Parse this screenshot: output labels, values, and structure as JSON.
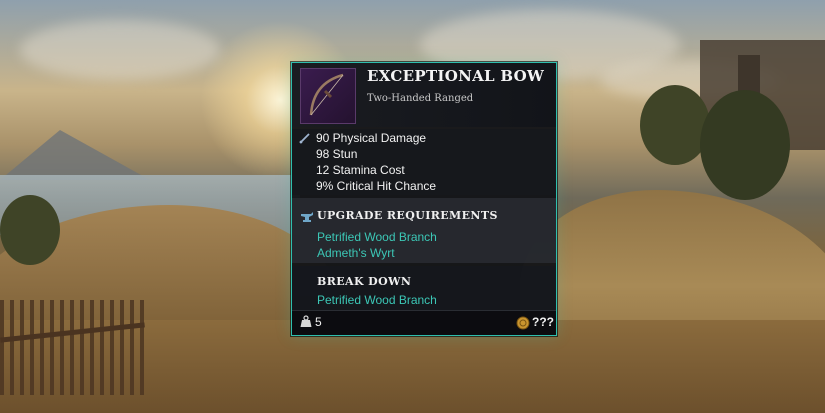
{
  "item": {
    "name": "EXCEPTIONAL BOW",
    "type": "Two-Handed Ranged",
    "icon": "bow-icon"
  },
  "stats": [
    "90 Physical Damage",
    "98 Stun",
    "12 Stamina Cost",
    "9% Critical Hit Chance"
  ],
  "upgrade": {
    "title": "UPGRADE REQUIREMENTS",
    "items": [
      "Petrified Wood Branch",
      "Admeth's Wyrt"
    ]
  },
  "breakdown": {
    "title": "BREAK DOWN",
    "items": [
      "Petrified Wood Branch"
    ]
  },
  "footer": {
    "weight": "5",
    "price": "???"
  },
  "colors": {
    "accent": "#2fbfae",
    "requirement_text": "#3cc7b6",
    "panel_bg": "#101216"
  }
}
